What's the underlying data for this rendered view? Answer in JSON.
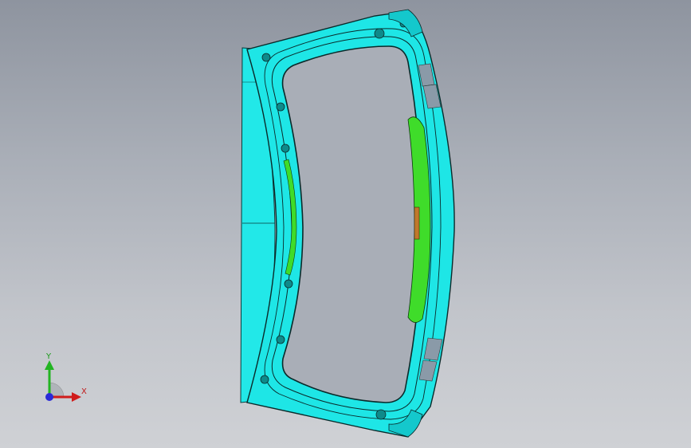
{
  "viewport": {
    "background_top": "#8e949f",
    "background_bottom": "#cfd1d5"
  },
  "model": {
    "part_color": "#1ee6e6",
    "part_shade": "#14c8cc",
    "edge_color": "#0a2a2a",
    "inner_part_color": "#3fdc2a",
    "pad_color": "#8a9aa8"
  },
  "triad": {
    "x_label": "X",
    "y_label": "Y",
    "x_color": "#d01c1c",
    "y_color": "#22b422",
    "z_color": "#2a2ad8"
  }
}
